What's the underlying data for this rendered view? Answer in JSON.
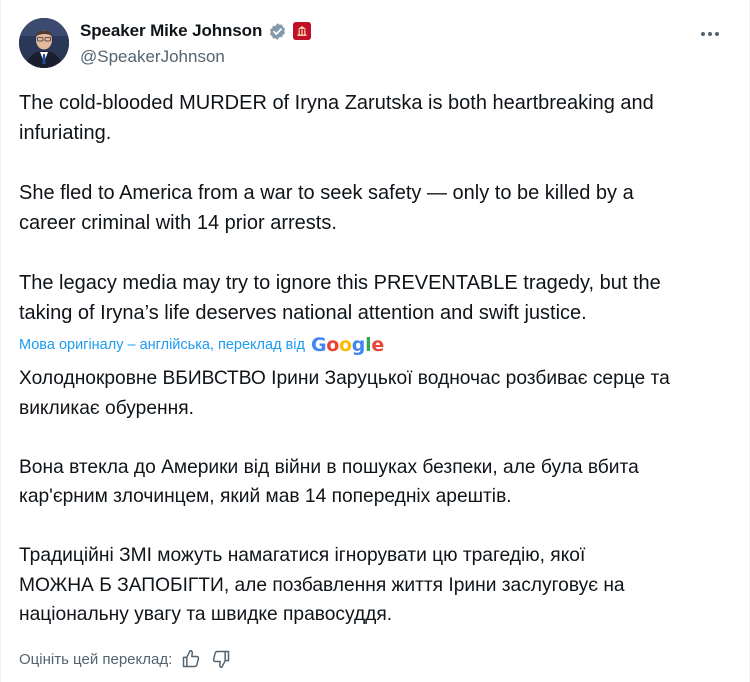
{
  "author": {
    "display_name": "Speaker Mike Johnson",
    "handle": "@SpeakerJohnson",
    "verified_icon": "verified-badge-icon",
    "affiliation_icon": "house-seal-icon"
  },
  "tweet": {
    "text": "The cold-blooded MURDER of Iryna Zarutska is both heartbreaking and\ninfuriating.\n\nShe fled to America from a war to seek safety — only to be killed by a\ncareer criminal with 14 prior arrests.\n\nThe legacy media may try to ignore this PREVENTABLE tragedy, but the\ntaking of Iryna’s life deserves national attention and swift justice."
  },
  "translation": {
    "notice": "Мова оригіналу – англійська, переклад від",
    "provider": "Google",
    "text": "Холоднокровне ВБИВСТВО Ірини Заруцької водночас розбиває серце та\nвикликає обурення.\n\nВона втекла до Америки від війни в пошуках безпеки, але була вбита\nкар'єрним злочинцем, який мав 14 попередніх арештів.\n\nТрадиційні ЗМІ можуть намагатися ігнорувати цю трагедію, якої\nМОЖНА Б ЗАПОБІГТИ, але позбавлення життя Ірини заслуговує на\nнаціональну увагу та швидке правосуддя.",
    "rate_label": "Оцініть цей переклад:"
  },
  "colors": {
    "link": "#1d9bf0",
    "secondary": "#536471",
    "verified": "#829aab",
    "affiliation": "#c0102a"
  }
}
